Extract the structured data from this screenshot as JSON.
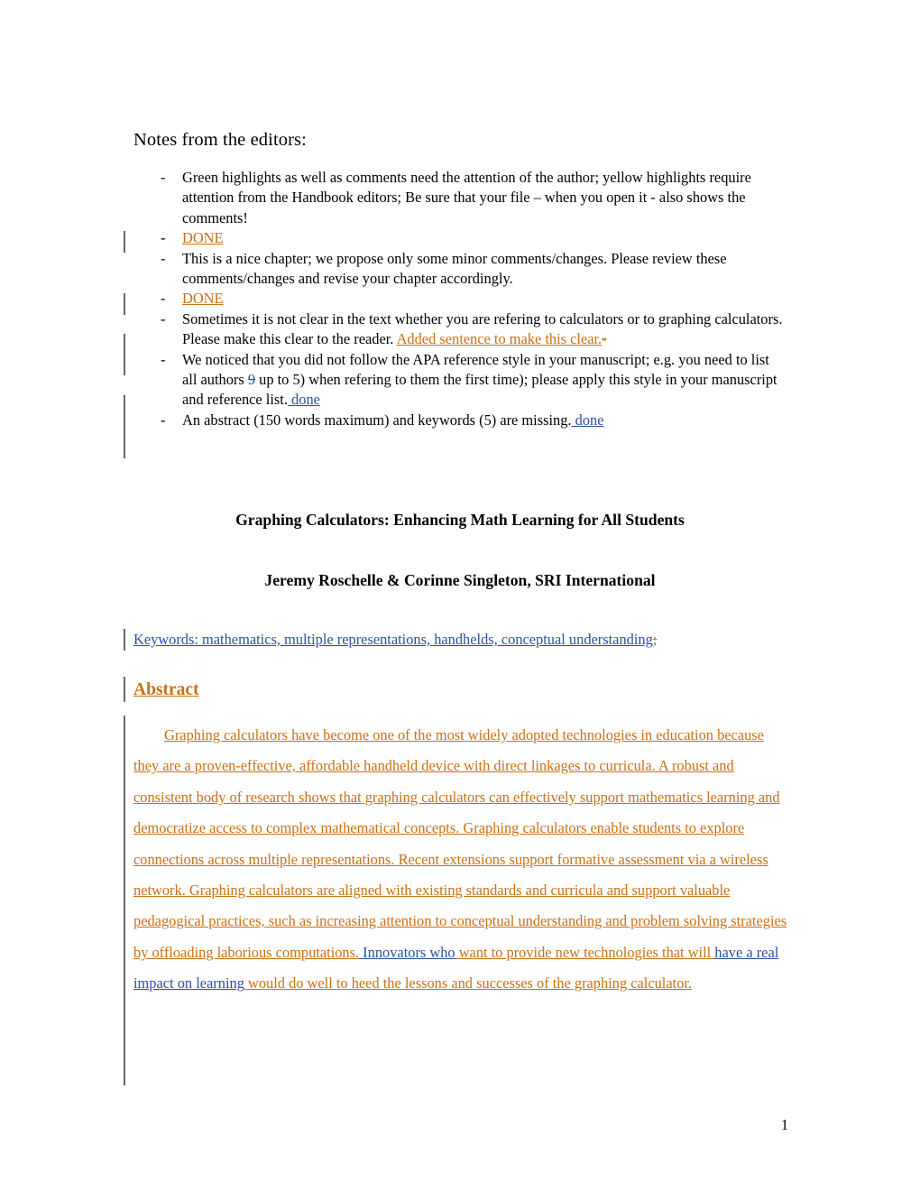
{
  "document": {
    "notes_heading": "Notes from the editors:",
    "bullet_marker": "-",
    "page_number": "1",
    "colors": {
      "insert_orange": "#CC6F12",
      "insert_blue": "#2B4FA2",
      "change_bar": "#666666",
      "body_text": "#000000"
    },
    "editor_notes": [
      {
        "id": "note-green-highlights",
        "plain": "Green highlights as well as comments need the attention of the author; yellow highlights require attention from the Handbook editors; Be sure that your file – when you open it - also shows the comments!"
      },
      {
        "id": "note-done-1",
        "insert_orange": "DONE"
      },
      {
        "id": "note-nice-chapter",
        "plain": "This is a nice chapter; we propose only some minor comments/changes. Please review these comments/changes and revise your chapter accordingly."
      },
      {
        "id": "note-done-2",
        "insert_orange": "DONE"
      },
      {
        "id": "note-calculators-clarity",
        "plain": "Sometimes it is not clear in the text whether you are refering to calculators or to graphing calculators. Please make this clear to the reader. ",
        "insert_orange": "Added sentence to make this clear.",
        "delete_orange": "-"
      },
      {
        "id": "note-apa-style",
        "plain_a": "We noticed that you did not follow the APA reference style in your manuscript; e.g. you need to list all authors ",
        "delete_blue": "9",
        "plain_b": " up to 5) when refering to them the first time); please apply this style in your manuscript and reference list.",
        "insert_blue": " done"
      },
      {
        "id": "note-abstract-missing",
        "plain": "An abstract (150 words maximum) and keywords (5) are missing.",
        "insert_blue": " done"
      }
    ],
    "chapter": {
      "title": "Graphing Calculators: Enhancing Math Learning for All Students",
      "authors": "Jeremy Roschelle & Corinne Singleton, SRI International"
    },
    "keywords": {
      "insert_blue": "Keywords: mathematics, multiple representations, handhelds, conceptual understanding",
      "delete_orange": ";"
    },
    "abstract": {
      "heading": "Abstract",
      "part_orange_1": "Graphing calculators have become one of the most widely adopted technologies in education because they are a proven-effective, affordable handheld device with direct linkages to curricula. A robust and consistent body of research shows that graphing calculators can effectively support mathematics learning and democratize access to complex mathematical concepts. Graphing calculators enable students to explore connections across multiple representations. Recent extensions support formative assessment via a wireless network.  Graphing calculators are aligned with existing standards and curricula and support valuable pedagogical practices, such as increasing attention to conceptual understanding and problem solving strategies by offloading laborious computations.",
      "part_blue_1": " Innovators who",
      "part_orange_2": " want to provide new technologies that will ",
      "part_blue_2": "have a real impact on learning",
      "part_orange_3": " would do well to heed the lessons and successes of the graphing calculator. "
    }
  }
}
